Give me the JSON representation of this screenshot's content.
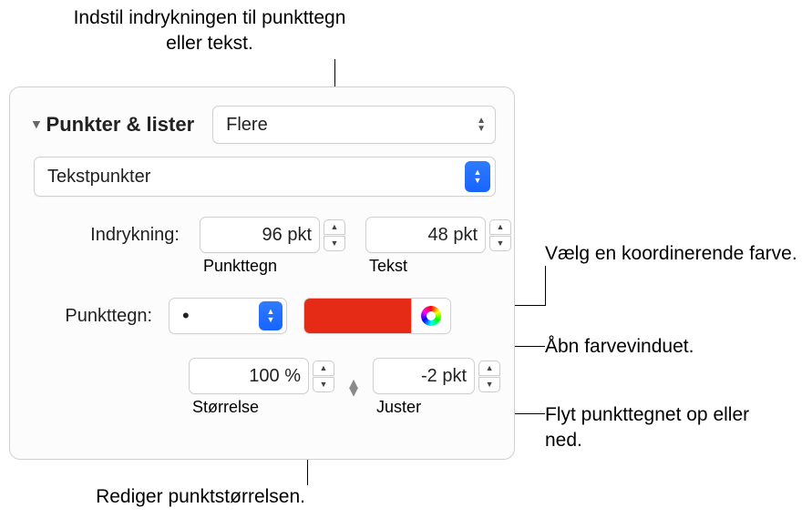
{
  "callouts": {
    "top": "Indstil indrykningen til punkttegn eller tekst.",
    "right_swatch": "Vælg en koordinerende farve.",
    "right_wheel": "Åbn farvevinduet.",
    "right_align": "Flyt punkttegnet op eller ned.",
    "bottom": "Rediger punktstørrelsen."
  },
  "panel": {
    "section_title": "Punkter & lister",
    "style_popup": "Flere",
    "type_select": "Tekstpunkter",
    "indent_label": "Indrykning:",
    "indent_bullet_value": "96 pkt",
    "indent_text_value": "48 pkt",
    "indent_bullet_sub": "Punkttegn",
    "indent_text_sub": "Tekst",
    "bullet_label": "Punkttegn:",
    "bullet_glyph": "•",
    "bullet_color": "#e52a15",
    "size_value": "100 %",
    "size_sub": "Størrelse",
    "align_value": "-2 pkt",
    "align_sub": "Juster"
  }
}
